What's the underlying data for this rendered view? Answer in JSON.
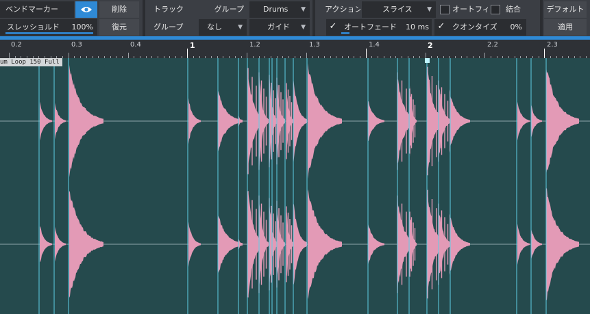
{
  "toolbar": {
    "bend_marker_label": "ベンドマーカー",
    "delete_label": "削除",
    "threshold_label": "スレッショルド",
    "threshold_value": "100%",
    "restore_label": "復元",
    "track_label": "トラック",
    "group_label_top": "グループ",
    "group_select_value": "Drums",
    "group_label_bottom": "グループ",
    "group_none_value": "なし",
    "guide_value": "ガイド",
    "action_label": "アクション",
    "slice_value": "スライス",
    "autofill_label": "オートフィル",
    "join_label": "結合",
    "default_label": "デフォルト",
    "autofade_label": "オートフェード",
    "autofade_value": "10 ms",
    "quantize_label": "クオンタイズ",
    "quantize_value": "0%",
    "apply_label": "適用"
  },
  "ruler": {
    "labels": [
      {
        "text": "0.2",
        "major": false
      },
      {
        "text": "0.3",
        "major": false
      },
      {
        "text": "0.4",
        "major": false
      },
      {
        "text": "1",
        "major": true
      },
      {
        "text": "1.2",
        "major": false
      },
      {
        "text": "1.3",
        "major": false
      },
      {
        "text": "1.4",
        "major": false
      },
      {
        "text": "2",
        "major": true
      },
      {
        "text": "2.2",
        "major": false
      },
      {
        "text": "2.3",
        "major": false
      }
    ]
  },
  "clip": {
    "name": "um Loop 150 Full"
  },
  "colors": {
    "toolbar_bg": "#3b3e44",
    "accent_blue": "#2f8ad6",
    "clip_bg": "#254a4d",
    "waveform": "#e39ab6",
    "bend_marker": "#5fd0e6"
  },
  "icons": {
    "eye": "eye-icon",
    "check": "check-icon",
    "dropdown": "chevron-down-icon"
  }
}
